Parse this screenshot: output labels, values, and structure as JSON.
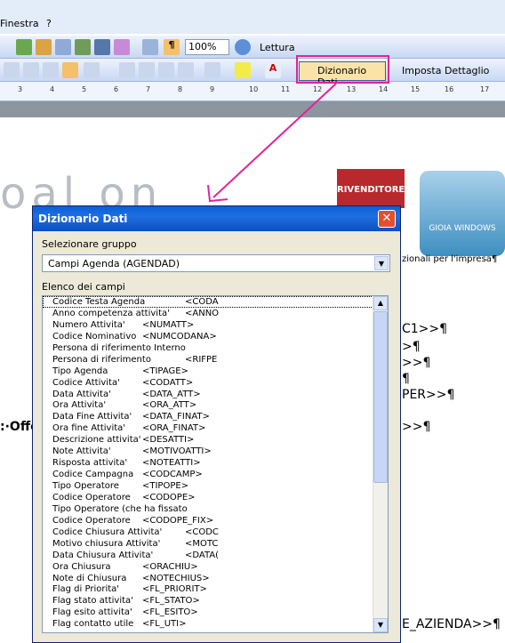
{
  "menubar": {
    "items": [
      "Finestra",
      "?"
    ]
  },
  "toolbar1": {
    "zoom": "100%",
    "lettura_label": "Lettura"
  },
  "toolbar2": {
    "dizionario_label": "Dizionario Dati",
    "imposta_label": "Imposta Dettaglio"
  },
  "ruler": {
    "marks": [
      "3",
      "4",
      "5",
      "6",
      "7",
      "8",
      "9",
      "10",
      "11",
      "12",
      "13",
      "14",
      "15",
      "16",
      "17"
    ]
  },
  "document": {
    "logo_text": "oal on",
    "rivenditore": "RIVENDITORE",
    "gioia": "GIOIA WINDOWS",
    "tagline": "zionali per l'impresa¶",
    "lines": [
      "C1>>¶",
      ">¶",
      ">>¶",
      "¶",
      "PER>>¶",
      ">>¶",
      "E_AZIENDA>>¶"
    ],
    "left_text": ":·Offe"
  },
  "dialog": {
    "title": "Dizionario Dati",
    "group_label": "Selezionare gruppo",
    "group_value": "Campi Agenda  (AGENDAD)",
    "list_label": "Elenco dei campi",
    "fields": [
      {
        "name": "Codice Testa Agenda",
        "code": "<CODA"
      },
      {
        "name": "Anno competenza attivita'",
        "code": "<ANNO"
      },
      {
        "name": "Numero Attivita'",
        "code": "<NUMATT>"
      },
      {
        "name": "Codice Nominativo",
        "code": "<NUMCODANA>"
      },
      {
        "name": "Persona di riferimento Interno",
        "code": ""
      },
      {
        "name": "Persona di riferimento",
        "code": "<RIFPE"
      },
      {
        "name": "Tipo Agenda",
        "code": "<TIPAGE>"
      },
      {
        "name": "Codice Attivita'",
        "code": "<CODATT>"
      },
      {
        "name": "Data Attivita'",
        "code": "<DATA_ATT>"
      },
      {
        "name": "Ora Attivita'",
        "code": "<ORA_ATT>"
      },
      {
        "name": "Data Fine Attivita'",
        "code": "<DATA_FINAT>"
      },
      {
        "name": "Ora fine Attivita'",
        "code": "<ORA_FINAT>"
      },
      {
        "name": "Descrizione attivita'",
        "code": "<DESATTI>"
      },
      {
        "name": "Note Attivita'",
        "code": "<MOTIVOATTI>"
      },
      {
        "name": "Risposta attivita'",
        "code": "<NOTEATTI>"
      },
      {
        "name": "Codice Campagna",
        "code": "<CODCAMP>"
      },
      {
        "name": "Tipo Operatore",
        "code": "<TIPOPE>"
      },
      {
        "name": "Codice Operatore",
        "code": "<CODOPE>"
      },
      {
        "name": "Tipo Operatore (che ha fissato",
        "code": ""
      },
      {
        "name": "Codice Operatore",
        "code": "<CODOPE_FIX>"
      },
      {
        "name": "Codice Chiusura Attivita'",
        "code": "<CODC"
      },
      {
        "name": "Motivo chiusura Attivita'",
        "code": "<MOTC"
      },
      {
        "name": "Data Chiusura Attivita'",
        "code": "<DATA("
      },
      {
        "name": "Ora Chiusura",
        "code": "<ORACHIU>"
      },
      {
        "name": "Note di Chiusura",
        "code": "<NOTECHIUS>"
      },
      {
        "name": "Flag di Priorita'",
        "code": "<FL_PRIORIT>"
      },
      {
        "name": "Flag stato attivita'",
        "code": "<FL_STATO>"
      },
      {
        "name": "Flag esito attivita'",
        "code": "<FL_ESITO>"
      },
      {
        "name": "Flag contatto utile",
        "code": "<FL_UTI>"
      }
    ]
  },
  "colors": {
    "highlight": "#e0249a",
    "title_bar": "#0a5fd8"
  }
}
